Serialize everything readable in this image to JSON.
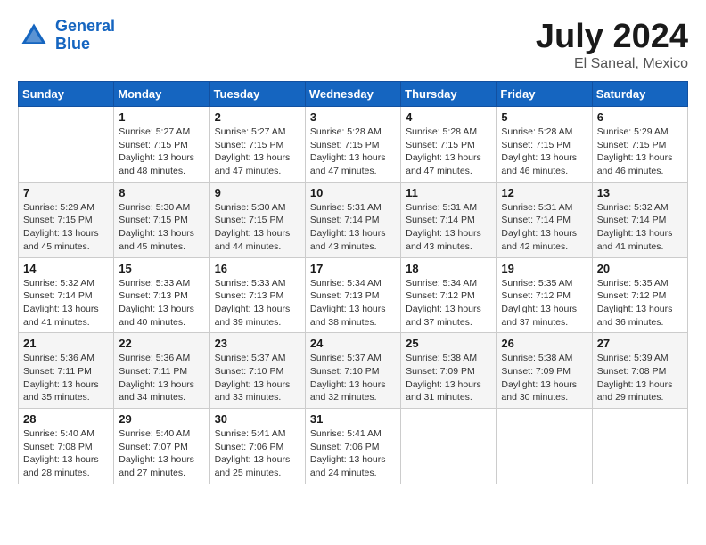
{
  "header": {
    "logo_line1": "General",
    "logo_line2": "Blue",
    "title": "July 2024",
    "subtitle": "El Saneal, Mexico"
  },
  "weekdays": [
    "Sunday",
    "Monday",
    "Tuesday",
    "Wednesday",
    "Thursday",
    "Friday",
    "Saturday"
  ],
  "weeks": [
    [
      {
        "day": "",
        "sunrise": "",
        "sunset": "",
        "daylight": ""
      },
      {
        "day": "1",
        "sunrise": "Sunrise: 5:27 AM",
        "sunset": "Sunset: 7:15 PM",
        "daylight": "Daylight: 13 hours and 48 minutes."
      },
      {
        "day": "2",
        "sunrise": "Sunrise: 5:27 AM",
        "sunset": "Sunset: 7:15 PM",
        "daylight": "Daylight: 13 hours and 47 minutes."
      },
      {
        "day": "3",
        "sunrise": "Sunrise: 5:28 AM",
        "sunset": "Sunset: 7:15 PM",
        "daylight": "Daylight: 13 hours and 47 minutes."
      },
      {
        "day": "4",
        "sunrise": "Sunrise: 5:28 AM",
        "sunset": "Sunset: 7:15 PM",
        "daylight": "Daylight: 13 hours and 47 minutes."
      },
      {
        "day": "5",
        "sunrise": "Sunrise: 5:28 AM",
        "sunset": "Sunset: 7:15 PM",
        "daylight": "Daylight: 13 hours and 46 minutes."
      },
      {
        "day": "6",
        "sunrise": "Sunrise: 5:29 AM",
        "sunset": "Sunset: 7:15 PM",
        "daylight": "Daylight: 13 hours and 46 minutes."
      }
    ],
    [
      {
        "day": "7",
        "sunrise": "Sunrise: 5:29 AM",
        "sunset": "Sunset: 7:15 PM",
        "daylight": "Daylight: 13 hours and 45 minutes."
      },
      {
        "day": "8",
        "sunrise": "Sunrise: 5:30 AM",
        "sunset": "Sunset: 7:15 PM",
        "daylight": "Daylight: 13 hours and 45 minutes."
      },
      {
        "day": "9",
        "sunrise": "Sunrise: 5:30 AM",
        "sunset": "Sunset: 7:15 PM",
        "daylight": "Daylight: 13 hours and 44 minutes."
      },
      {
        "day": "10",
        "sunrise": "Sunrise: 5:31 AM",
        "sunset": "Sunset: 7:14 PM",
        "daylight": "Daylight: 13 hours and 43 minutes."
      },
      {
        "day": "11",
        "sunrise": "Sunrise: 5:31 AM",
        "sunset": "Sunset: 7:14 PM",
        "daylight": "Daylight: 13 hours and 43 minutes."
      },
      {
        "day": "12",
        "sunrise": "Sunrise: 5:31 AM",
        "sunset": "Sunset: 7:14 PM",
        "daylight": "Daylight: 13 hours and 42 minutes."
      },
      {
        "day": "13",
        "sunrise": "Sunrise: 5:32 AM",
        "sunset": "Sunset: 7:14 PM",
        "daylight": "Daylight: 13 hours and 41 minutes."
      }
    ],
    [
      {
        "day": "14",
        "sunrise": "Sunrise: 5:32 AM",
        "sunset": "Sunset: 7:14 PM",
        "daylight": "Daylight: 13 hours and 41 minutes."
      },
      {
        "day": "15",
        "sunrise": "Sunrise: 5:33 AM",
        "sunset": "Sunset: 7:13 PM",
        "daylight": "Daylight: 13 hours and 40 minutes."
      },
      {
        "day": "16",
        "sunrise": "Sunrise: 5:33 AM",
        "sunset": "Sunset: 7:13 PM",
        "daylight": "Daylight: 13 hours and 39 minutes."
      },
      {
        "day": "17",
        "sunrise": "Sunrise: 5:34 AM",
        "sunset": "Sunset: 7:13 PM",
        "daylight": "Daylight: 13 hours and 38 minutes."
      },
      {
        "day": "18",
        "sunrise": "Sunrise: 5:34 AM",
        "sunset": "Sunset: 7:12 PM",
        "daylight": "Daylight: 13 hours and 37 minutes."
      },
      {
        "day": "19",
        "sunrise": "Sunrise: 5:35 AM",
        "sunset": "Sunset: 7:12 PM",
        "daylight": "Daylight: 13 hours and 37 minutes."
      },
      {
        "day": "20",
        "sunrise": "Sunrise: 5:35 AM",
        "sunset": "Sunset: 7:12 PM",
        "daylight": "Daylight: 13 hours and 36 minutes."
      }
    ],
    [
      {
        "day": "21",
        "sunrise": "Sunrise: 5:36 AM",
        "sunset": "Sunset: 7:11 PM",
        "daylight": "Daylight: 13 hours and 35 minutes."
      },
      {
        "day": "22",
        "sunrise": "Sunrise: 5:36 AM",
        "sunset": "Sunset: 7:11 PM",
        "daylight": "Daylight: 13 hours and 34 minutes."
      },
      {
        "day": "23",
        "sunrise": "Sunrise: 5:37 AM",
        "sunset": "Sunset: 7:10 PM",
        "daylight": "Daylight: 13 hours and 33 minutes."
      },
      {
        "day": "24",
        "sunrise": "Sunrise: 5:37 AM",
        "sunset": "Sunset: 7:10 PM",
        "daylight": "Daylight: 13 hours and 32 minutes."
      },
      {
        "day": "25",
        "sunrise": "Sunrise: 5:38 AM",
        "sunset": "Sunset: 7:09 PM",
        "daylight": "Daylight: 13 hours and 31 minutes."
      },
      {
        "day": "26",
        "sunrise": "Sunrise: 5:38 AM",
        "sunset": "Sunset: 7:09 PM",
        "daylight": "Daylight: 13 hours and 30 minutes."
      },
      {
        "day": "27",
        "sunrise": "Sunrise: 5:39 AM",
        "sunset": "Sunset: 7:08 PM",
        "daylight": "Daylight: 13 hours and 29 minutes."
      }
    ],
    [
      {
        "day": "28",
        "sunrise": "Sunrise: 5:40 AM",
        "sunset": "Sunset: 7:08 PM",
        "daylight": "Daylight: 13 hours and 28 minutes."
      },
      {
        "day": "29",
        "sunrise": "Sunrise: 5:40 AM",
        "sunset": "Sunset: 7:07 PM",
        "daylight": "Daylight: 13 hours and 27 minutes."
      },
      {
        "day": "30",
        "sunrise": "Sunrise: 5:41 AM",
        "sunset": "Sunset: 7:06 PM",
        "daylight": "Daylight: 13 hours and 25 minutes."
      },
      {
        "day": "31",
        "sunrise": "Sunrise: 5:41 AM",
        "sunset": "Sunset: 7:06 PM",
        "daylight": "Daylight: 13 hours and 24 minutes."
      },
      {
        "day": "",
        "sunrise": "",
        "sunset": "",
        "daylight": ""
      },
      {
        "day": "",
        "sunrise": "",
        "sunset": "",
        "daylight": ""
      },
      {
        "day": "",
        "sunrise": "",
        "sunset": "",
        "daylight": ""
      }
    ]
  ]
}
